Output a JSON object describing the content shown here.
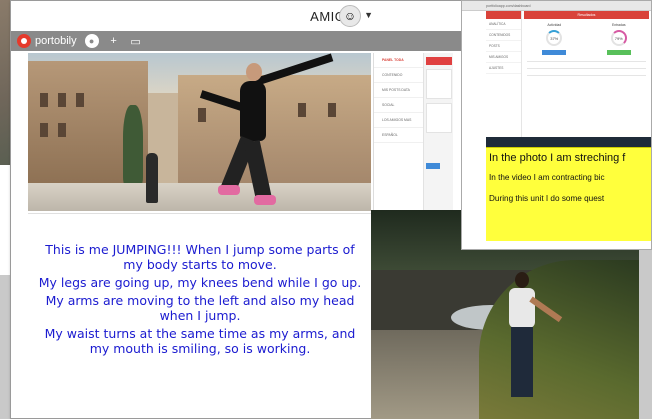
{
  "header": {
    "user_name": "AMIGO",
    "avatar_icon": "smiley-avatar",
    "caret_icon": "chevron-down-icon"
  },
  "toolbar": {
    "app_name": "portobily",
    "icons": [
      "camera-icon",
      "plus-icon",
      "folder-icon"
    ]
  },
  "side_panel": {
    "items": [
      "PANEL TODA",
      "CONTENIDO",
      "MIS POSTS DATA",
      "SOCIAL",
      "LOS AMIGOS MAS",
      "ESPAÑOL"
    ]
  },
  "story": {
    "lines": [
      "This is me JUMPING!!! When I jump some parts of my body starts to move.",
      "My legs are going up, my knees bend while I go up.",
      "My arms are moving to the left and also my head when I jump.",
      "My waist turns at the same time as my arms, and my mouth is smiling, so is working."
    ]
  },
  "dashboard": {
    "url": "portfolioapp.com/dashboard",
    "header": "Resultados",
    "side_items": [
      "ANALÍTICA",
      "CONTENIDOS",
      "POSTS",
      "MIS AMIGOS",
      "AJUSTES"
    ],
    "gauges": [
      {
        "label": "Actividad",
        "value": "37%"
      },
      {
        "label": "Entradas",
        "value": "79%"
      }
    ],
    "yellow_notes": [
      "In the photo I am streching f",
      "In the video I am contracting bic",
      "During this unit I do some quest"
    ]
  },
  "colors": {
    "story_text": "#1b1bd0",
    "toolbar_bg": "#8a8a8a",
    "accent_red": "#d9433a",
    "note_yellow": "#ffff3c"
  }
}
